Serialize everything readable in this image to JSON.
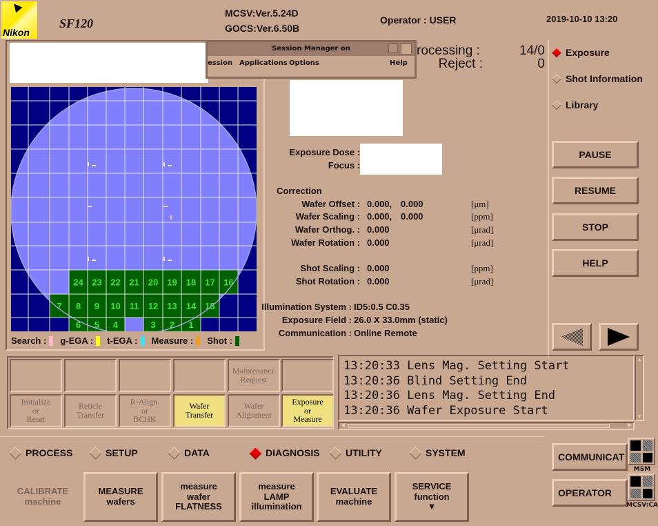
{
  "header": {
    "brand": "Nikon",
    "model": "SF120",
    "mcsv_version": "MCSV:Ver.5.24D",
    "gocs_version": "GOCS:Ver.6.50B",
    "operator": "Operator : USER",
    "datetime": "2019-10-10 13:20"
  },
  "session_manager": {
    "title": "Session Manager on",
    "menu": [
      "ession",
      "Applications",
      "Options",
      "Help"
    ]
  },
  "status": {
    "processing_label": "rocessing :",
    "processing_value": "14/0",
    "reject_label": "Reject :",
    "reject_value": "0"
  },
  "exposure": {
    "dose_label": "Exposure Dose :",
    "focus_label": "Focus :"
  },
  "correction": {
    "title": "Correction",
    "rows": [
      {
        "label": "Wafer Offset :",
        "v1": "0.000,",
        "v2": "0.000",
        "unit": "[μm]"
      },
      {
        "label": "Wafer Scaling :",
        "v1": "0.000,",
        "v2": "0.000",
        "unit": "[ppm]"
      },
      {
        "label": "Wafer Orthog. :",
        "v1": "0.000",
        "v2": "",
        "unit": "[μrad]"
      },
      {
        "label": "Wafer Rotation :",
        "v1": "0.000",
        "v2": "",
        "unit": "[μrad]"
      },
      {
        "label": "Shot Scaling :",
        "v1": "0.000",
        "v2": "",
        "unit": "[ppm]"
      },
      {
        "label": "Shot Rotation :",
        "v1": "0.000",
        "v2": "",
        "unit": "[μrad]"
      }
    ]
  },
  "system_info": [
    {
      "label": "Illumination System :",
      "value": "ID5:0.5 C0.35"
    },
    {
      "label": "Exposure Field :",
      "value": "26.0 X 33.0mm (static)"
    },
    {
      "label": "Communication :",
      "value": "Online Remote"
    }
  ],
  "view_options": [
    {
      "label": "Exposure",
      "selected": true
    },
    {
      "label": "Shot Information",
      "selected": false
    },
    {
      "label": "Library",
      "selected": false
    }
  ],
  "control_buttons": [
    "PAUSE",
    "RESUME",
    "STOP",
    "HELP"
  ],
  "nav_arrows": {
    "prev": "previous-arrow",
    "next": "next-arrow"
  },
  "wafer_map": {
    "legend": [
      {
        "label": "Search :",
        "color": "#ffb8c8"
      },
      {
        "label": "g-EGA :",
        "color": "#ffff00"
      },
      {
        "label": "t-EGA :",
        "color": "#40e0f0"
      },
      {
        "label": "Measure :",
        "color": "#f0a020"
      },
      {
        "label": "Shot :",
        "color": "#006000"
      }
    ],
    "colors": {
      "background": "#000080",
      "wafer": "#8080ff",
      "shot": "#006000",
      "shot_text": "#40e040",
      "grid": "#e0e0e0"
    },
    "shots": [
      {
        "n": "24",
        "c": 3,
        "r": 8
      },
      {
        "n": "23",
        "c": 4,
        "r": 8
      },
      {
        "n": "22",
        "c": 5,
        "r": 8
      },
      {
        "n": "21",
        "c": 6,
        "r": 8
      },
      {
        "n": "20",
        "c": 7,
        "r": 8
      },
      {
        "n": "19",
        "c": 8,
        "r": 8
      },
      {
        "n": "18",
        "c": 9,
        "r": 8
      },
      {
        "n": "17",
        "c": 10,
        "r": 8
      },
      {
        "n": "16",
        "c": 11,
        "r": 8
      },
      {
        "n": "7",
        "c": 2,
        "r": 9
      },
      {
        "n": "8",
        "c": 3,
        "r": 9
      },
      {
        "n": "9",
        "c": 4,
        "r": 9
      },
      {
        "n": "10",
        "c": 5,
        "r": 9
      },
      {
        "n": "11",
        "c": 6,
        "r": 9
      },
      {
        "n": "12",
        "c": 7,
        "r": 9
      },
      {
        "n": "13",
        "c": 8,
        "r": 9
      },
      {
        "n": "14",
        "c": 9,
        "r": 9
      },
      {
        "n": "15",
        "c": 10,
        "r": 9
      },
      {
        "n": "6",
        "c": 3,
        "r": 10
      },
      {
        "n": "5",
        "c": 4,
        "r": 10
      },
      {
        "n": "4",
        "c": 5,
        "r": 10
      },
      {
        "n": "3",
        "c": 7,
        "r": 10
      },
      {
        "n": "2",
        "c": 8,
        "r": 10
      },
      {
        "n": "1",
        "c": 9,
        "r": 10
      }
    ]
  },
  "sequence_grid": {
    "top": [
      "",
      "",
      "",
      "",
      "Maintenance\nRequest",
      ""
    ],
    "bottom": [
      {
        "label": "Initialize\nor\nReset",
        "active": false
      },
      {
        "label": "Reticle\nTransfer",
        "active": false
      },
      {
        "label": "R-Align.\nor\nBCHK",
        "active": false
      },
      {
        "label": "Wafer\nTransfer",
        "active": true
      },
      {
        "label": "Wafer\nAlignment",
        "active": false
      },
      {
        "label": "Exposure\nor\nMeasure",
        "active": true
      }
    ]
  },
  "log": [
    "13:20:33 Lens Mag. Setting Start",
    "13:20:36 Blind Setting End",
    "13:20:36 Lens Mag. Setting End",
    "13:20:36 Wafer Exposure Start"
  ],
  "mode_tabs": [
    {
      "label": "PROCESS",
      "selected": false
    },
    {
      "label": "SETUP",
      "selected": false
    },
    {
      "label": "DATA",
      "selected": false
    },
    {
      "label": "DIAGNOSIS",
      "selected": true
    },
    {
      "label": "UTILITY",
      "selected": false
    },
    {
      "label": "SYSTEM",
      "selected": false
    }
  ],
  "function_buttons": [
    {
      "label": "CALIBRATE\nmachine",
      "enabled": false
    },
    {
      "label": "MEASURE\nwafers",
      "enabled": true
    },
    {
      "label": "measure\nwafer\nFLATNESS",
      "enabled": true
    },
    {
      "label": "measure\nLAMP\nillumination",
      "enabled": true
    },
    {
      "label": "EVALUATE\nmachine",
      "enabled": true
    },
    {
      "label": "SERVICE\nfunction\n▼",
      "enabled": true
    }
  ],
  "side_windows": [
    {
      "label": "COMMUNICAT",
      "icon_caption": "MSM"
    },
    {
      "label": "OPERATOR",
      "icon_caption": "MCSV:CA"
    }
  ]
}
